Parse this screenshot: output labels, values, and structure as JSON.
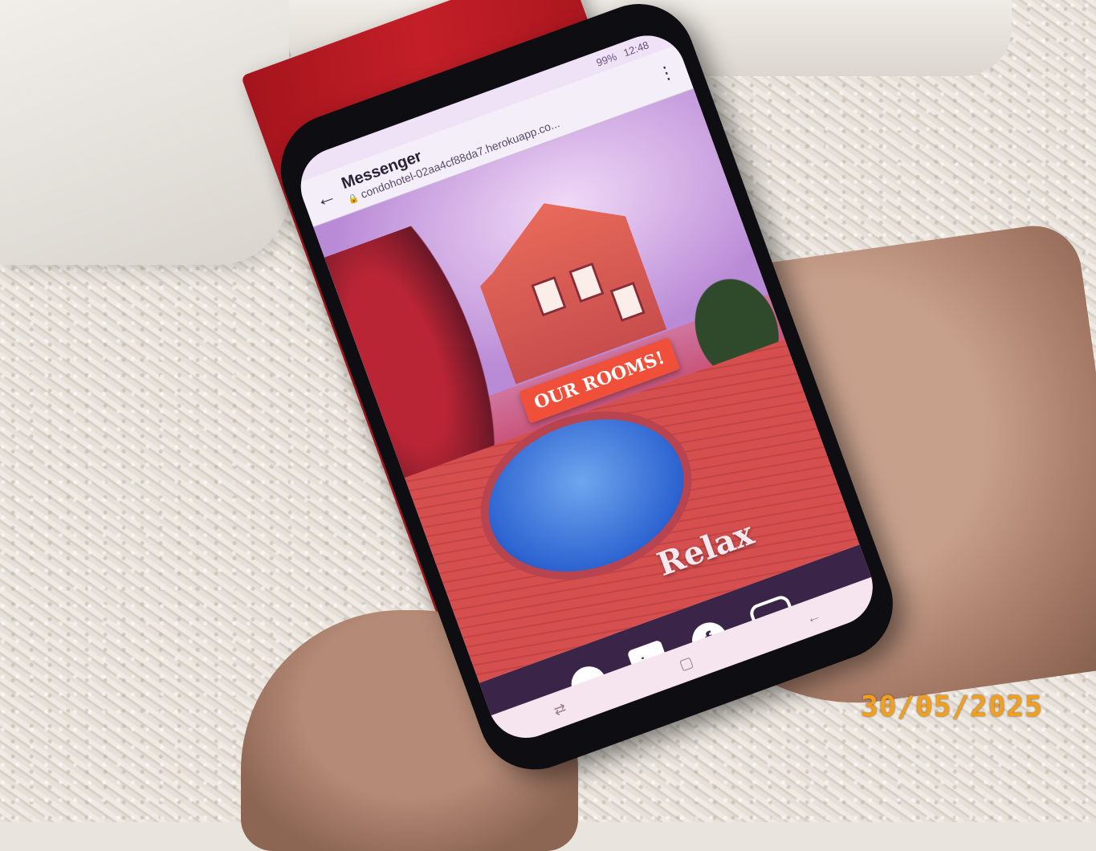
{
  "status_bar": {
    "battery": "99%",
    "time": "12:48"
  },
  "browser": {
    "title": "Messenger",
    "url": "condohotel-02aa4cf88da7.herokuapp.co...",
    "back_icon": "arrow-left-icon",
    "menu_icon": "more-vertical-icon",
    "lock_icon": "lock-icon"
  },
  "hero": {
    "button_label": "OUR ROOMS!",
    "caption": "Relax"
  },
  "footer": {
    "social_icons": [
      "github-icon",
      "linkedin-icon",
      "facebook-icon",
      "instagram-icon"
    ],
    "linkedin_glyph": "in",
    "facebook_glyph": "f",
    "instagram_glyph": "◎",
    "github_glyph": "●"
  },
  "nav_bar": {
    "recent": "⇄",
    "home": "▢",
    "back": "←"
  },
  "photo": {
    "date_stamp": "30/05/2025"
  },
  "colors": {
    "footer": "#3a2448",
    "button": "#f0503a",
    "stamp": "#f0a020"
  }
}
